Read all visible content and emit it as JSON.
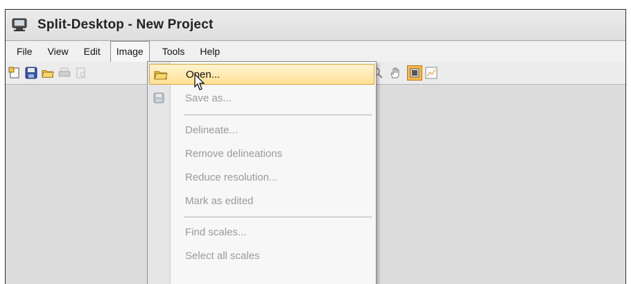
{
  "window": {
    "title": "Split-Desktop - New Project"
  },
  "menubar": {
    "items": [
      "File",
      "View",
      "Edit",
      "Image",
      "Tools",
      "Help"
    ]
  },
  "image_menu": {
    "open": "Open...",
    "save_as": "Save as...",
    "delineate": "Delineate...",
    "remove_delineations": "Remove delineations",
    "reduce_resolution": "Reduce resolution...",
    "mark_as_edited": "Mark as edited",
    "find_scales": "Find scales...",
    "select_all_scales": "Select all scales"
  },
  "colors": {
    "highlight_top": "#fff4cf",
    "highlight_bottom": "#ffe196",
    "highlight_border": "#d8a23a"
  }
}
